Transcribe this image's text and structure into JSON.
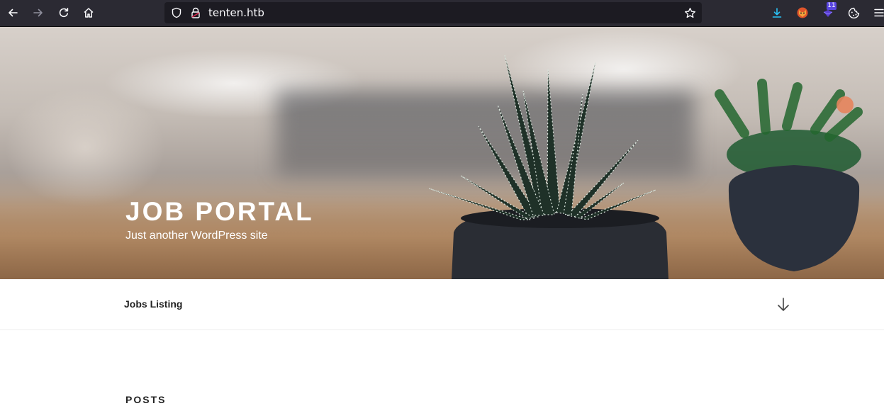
{
  "browser": {
    "url": "tenten.htb",
    "extension_badge_count": "11"
  },
  "site": {
    "title": "JOB PORTAL",
    "description": "Just another WordPress site"
  },
  "nav": {
    "items": [
      {
        "label": "Jobs Listing"
      }
    ]
  },
  "content": {
    "section_title": "POSTS"
  },
  "colors": {
    "toolbar_bg": "#2b2a33",
    "urlbar_bg": "#1c1b22",
    "download_icon": "#2ac3f6",
    "extension_purple": "#5a46e0",
    "text_dark": "#222222"
  },
  "icons": [
    "back-icon",
    "forward-icon",
    "reload-icon",
    "home-icon",
    "shield-icon",
    "lock-icon",
    "star-icon",
    "download-icon",
    "extension-fox-icon",
    "extension-purple-icon",
    "cookie-icon",
    "menu-icon",
    "arrow-down-icon"
  ]
}
